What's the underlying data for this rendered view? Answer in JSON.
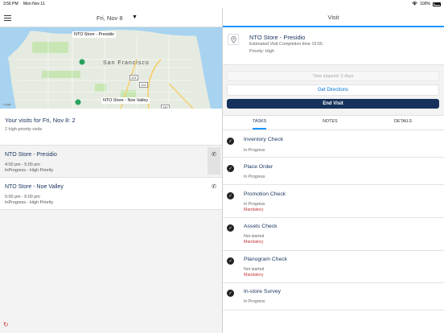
{
  "status_bar": {
    "time": "3:56 PM",
    "date": "Mon Nov 11",
    "battery": "100%"
  },
  "left": {
    "header": {
      "date": "Fri, Nov 8"
    },
    "map": {
      "labels": [
        "NTO Store - Presidio",
        "NTO Store - Noe Valley"
      ],
      "city": "San Francisco",
      "legal": "Legal",
      "highways": [
        "101",
        "101",
        "280"
      ]
    },
    "summary": {
      "title": "Your visits for Fri, Nov 8: 2",
      "subtitle": "2 high-priority visits"
    },
    "visits": [
      {
        "name": "NTO Store - Presidio",
        "time": "4:00 pm - 5:00 pm",
        "status": "InProgress - High Priority"
      },
      {
        "name": "NTO Store - Noe Valley",
        "time": "5:00 pm - 6:00 pm",
        "status": "InProgress - High Priority"
      }
    ]
  },
  "right": {
    "header": {
      "title": "Visit"
    },
    "store": {
      "name": "NTO Store - Presidio",
      "estimate": "Estimated Visit Completion time 15:55",
      "priority": "Priority: High"
    },
    "actions": {
      "elapsed": "Time elapsed: 5 days",
      "directions": "Get Directions",
      "end_visit": "End Visit"
    },
    "tabs": [
      "TASKS",
      "NOTES",
      "DETAILS"
    ],
    "tasks": [
      {
        "name": "Inventory Check",
        "status": "In Progress",
        "mandatory": ""
      },
      {
        "name": "Place Order",
        "status": "In Progress",
        "mandatory": ""
      },
      {
        "name": "Promotion Check",
        "status": "In Progress",
        "mandatory": "Mandatory"
      },
      {
        "name": "Assets Check",
        "status": "Not started",
        "mandatory": "Mandatory"
      },
      {
        "name": "Planogram Check",
        "status": "Not started",
        "mandatory": "Mandatory"
      },
      {
        "name": "In-store Survey",
        "status": "In Progress",
        "mandatory": ""
      }
    ]
  },
  "colors": {
    "accent": "#1b96ff",
    "navy": "#16325c",
    "link": "#0070d2",
    "mandatory": "#c23934"
  }
}
